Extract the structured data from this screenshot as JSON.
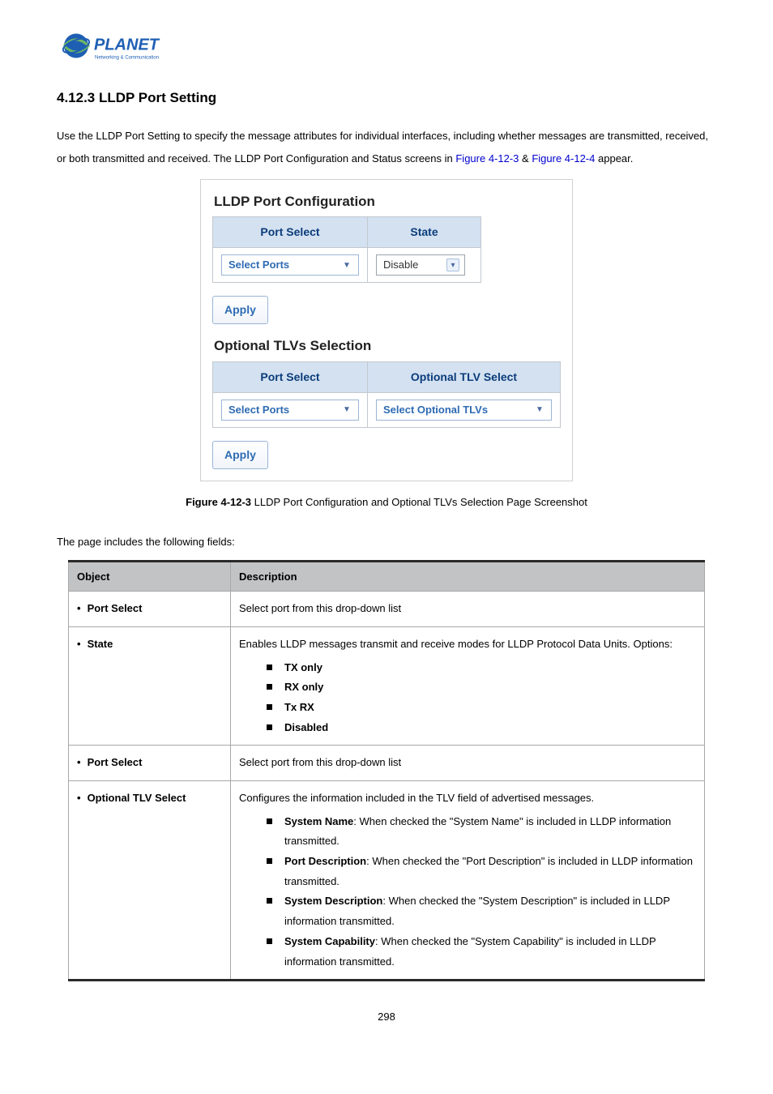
{
  "logo": {
    "brand": "PLANET",
    "tagline": "Networking & Communication"
  },
  "heading": "4.12.3 LLDP Port Setting",
  "intro": {
    "pre": "Use the LLDP Port Setting to specify the message attributes for individual interfaces, including whether messages are transmitted, received, or both transmitted and received. The LLDP Port Configuration and Status screens in ",
    "link1": "Figure 4-12-3",
    "amp": " & ",
    "link2": "Figure 4-12-4",
    "post": " appear."
  },
  "figure": {
    "panel1_title": "LLDP Port Configuration",
    "hdr_port_select": "Port Select",
    "hdr_state": "State",
    "dd_ports": "Select Ports",
    "dd_state": "Disable",
    "apply": "Apply",
    "panel2_title": "Optional TLVs Selection",
    "hdr_opt_tlv": "Optional TLV Select",
    "dd_ports2": "Select Ports",
    "dd_tlvs": "Select Optional TLVs"
  },
  "caption": {
    "bold": "Figure 4-12-3",
    "rest": " LLDP Port Configuration and Optional TLVs Selection Page Screenshot"
  },
  "fields_intro": "The page includes the following fields:",
  "table": {
    "hdr_object": "Object",
    "hdr_desc": "Description",
    "rows": {
      "port_select1": {
        "obj": "Port Select",
        "desc": "Select port from this drop-down list"
      },
      "state": {
        "obj": "State",
        "desc": "Enables LLDP messages transmit and receive modes for LLDP Protocol Data Units. Options:",
        "options": [
          "TX only",
          "RX only",
          "Tx RX",
          "Disabled"
        ]
      },
      "port_select2": {
        "obj": "Port Select",
        "desc": "Select port from this drop-down list"
      },
      "opt_tlv": {
        "obj": "Optional TLV Select",
        "desc": "Configures the information included in the TLV field of advertised messages.",
        "items": [
          {
            "label": "System Name",
            "text": ": When checked the \"System Name\" is included in LLDP information transmitted."
          },
          {
            "label": "Port Description",
            "text": ": When checked the \"Port Description\" is included in LLDP information transmitted."
          },
          {
            "label": "System Description",
            "text": ": When checked the \"System Description\" is included in LLDP information transmitted."
          },
          {
            "label": "System Capability",
            "text": ": When checked the \"System Capability\" is included in LLDP information transmitted."
          }
        ]
      }
    }
  },
  "pagenum": "298"
}
